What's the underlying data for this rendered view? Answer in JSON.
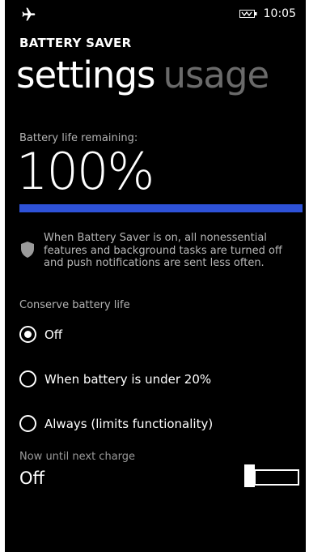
{
  "status_bar": {
    "icons": [
      "airplane-icon",
      "battery-saver-icon"
    ],
    "time": "10:05"
  },
  "app": {
    "title": "BATTERY SAVER"
  },
  "pivot": {
    "tabs": [
      {
        "label": "settings",
        "active": true
      },
      {
        "label": "usage",
        "active": false
      }
    ]
  },
  "battery": {
    "label": "Battery life remaining:",
    "value": "100%",
    "level_percent": 100,
    "bar_color": "#2e52d8"
  },
  "info": {
    "icon": "shield-icon",
    "text": "When Battery Saver is on, all nonessential features and background tasks are turned off and push notifications are sent less often."
  },
  "conserve": {
    "label": "Conserve battery life",
    "options": [
      {
        "label": "Off",
        "selected": true
      },
      {
        "label": "When battery is under 20%",
        "selected": false
      },
      {
        "label": "Always (limits functionality)",
        "selected": false
      }
    ]
  },
  "until_charge": {
    "label": "Now until next charge",
    "value": "Off",
    "toggle_on": false
  }
}
